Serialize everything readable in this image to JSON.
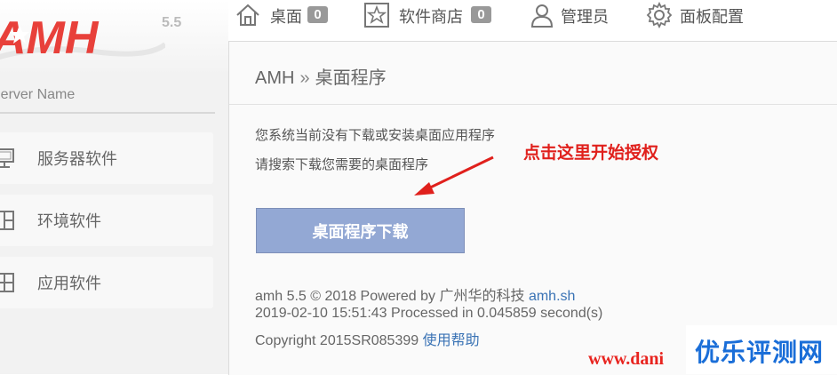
{
  "logo": {
    "text": "AMH",
    "version": "5.5"
  },
  "sidebar": {
    "server_name_placeholder": "Server Name",
    "items": [
      {
        "label": "服务器软件",
        "icon": "monitor-icon"
      },
      {
        "label": "环境软件",
        "icon": "grid-window-icon"
      },
      {
        "label": "应用软件",
        "icon": "app-grid-icon"
      }
    ]
  },
  "topnav": {
    "items": [
      {
        "label": "桌面",
        "icon": "home-icon",
        "badge": "0"
      },
      {
        "label": "软件商店",
        "icon": "star-icon",
        "badge": "0"
      },
      {
        "label": "管理员",
        "icon": "user-icon"
      },
      {
        "label": "面板配置",
        "icon": "gear-icon"
      }
    ]
  },
  "main": {
    "breadcrumb_root": "AMH",
    "breadcrumb_sep": "»",
    "breadcrumb_current": "桌面程序",
    "message_line1": "您系统当前没有下载或安装桌面应用程序",
    "message_line2": "请搜索下载您需要的桌面程序",
    "download_button": "桌面程序下载"
  },
  "footer": {
    "powered_prefix": "amh 5.5 © 2018 Powered by",
    "company": "广州华的科技",
    "site_link": "amh.sh",
    "processed": "2019-02-10 15:51:43 Processed in 0.045859 second(s)",
    "copyright": "Copyright 2015SR085399",
    "help_link": "使用帮助"
  },
  "annotation": {
    "text": "点击这里开始授权"
  },
  "watermark": {
    "cn": "优乐评测网",
    "url": "www.dani"
  },
  "colors": {
    "logo_red": "#e8403a",
    "button_bg": "#93a8d4",
    "link_blue": "#3a73b5",
    "annotation_red": "#e0201c",
    "watermark_blue": "#1a6ed8"
  }
}
